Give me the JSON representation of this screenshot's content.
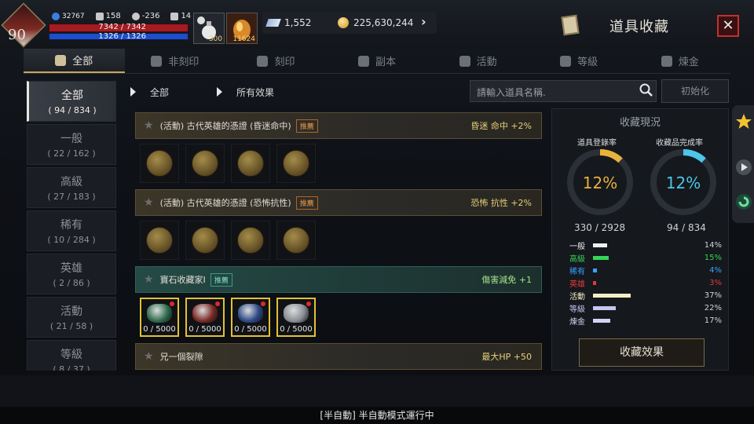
{
  "player": {
    "level": "90",
    "combat_power": "32767",
    "stat_a": "158",
    "stat_b": "-236",
    "stat_c": "14",
    "hp": "7342 / 7342",
    "mp": "1326 / 1326"
  },
  "quick_slots": [
    {
      "icon": "potion-icon",
      "count": "300"
    },
    {
      "icon": "elixir-icon",
      "count": "11624"
    }
  ],
  "currency": {
    "gems": "1,552",
    "gold": "225,630,244"
  },
  "window_title": "道具收藏",
  "tabs": [
    {
      "label": "全部",
      "icon": "book-icon",
      "active": true
    },
    {
      "label": "非刻印",
      "icon": "no-engrave-icon",
      "active": false
    },
    {
      "label": "刻印",
      "icon": "engrave-icon",
      "active": false
    },
    {
      "label": "副本",
      "icon": "dungeon-icon",
      "active": false
    },
    {
      "label": "活動",
      "icon": "gift-icon",
      "active": false
    },
    {
      "label": "等級",
      "icon": "level-icon",
      "active": false
    },
    {
      "label": "煉金",
      "icon": "alchemy-icon",
      "active": false
    }
  ],
  "categories": [
    {
      "name": "全部",
      "count": "( 94 / 834 )",
      "active": true
    },
    {
      "name": "一般",
      "count": "( 22 / 162 )"
    },
    {
      "name": "高級",
      "count": "( 27 / 183 )"
    },
    {
      "name": "稀有",
      "count": "( 10 / 284 )"
    },
    {
      "name": "英雄",
      "count": "( 2 / 86 )"
    },
    {
      "name": "活動",
      "count": "( 21 / 58 )"
    },
    {
      "name": "等級",
      "count": "( 8 / 37 )"
    }
  ],
  "filter": {
    "type": "全部",
    "effect": "所有效果",
    "search_placeholder": "請輸入道具名稱.",
    "reset_label": "初始化"
  },
  "collections": [
    {
      "name": "(活動) 古代英雄的憑證 (昏迷命中)",
      "tag": "推薦",
      "effect": "昏迷 命中 +2%",
      "style": "gold",
      "items": [
        {
          "type": "medal"
        },
        {
          "type": "medal"
        },
        {
          "type": "medal"
        },
        {
          "type": "medal"
        }
      ]
    },
    {
      "name": "(活動) 古代英雄的憑證 (恐怖抗性)",
      "tag": "推薦",
      "effect": "恐怖 抗性 +2%",
      "style": "gold",
      "items": [
        {
          "type": "medal"
        },
        {
          "type": "medal"
        },
        {
          "type": "medal"
        },
        {
          "type": "medal"
        }
      ]
    },
    {
      "name": "寶石收藏家I",
      "tag": "推薦",
      "effect": "傷害減免 +1",
      "style": "teal",
      "items": [
        {
          "type": "gem",
          "color": "#2f6b4c",
          "qty": "0 / 5000"
        },
        {
          "type": "gem",
          "color": "#7a2a26",
          "qty": "0 / 5000"
        },
        {
          "type": "gem",
          "color": "#2c4a86",
          "qty": "0 / 5000"
        },
        {
          "type": "gem",
          "color": "#8a8e96",
          "qty": "0 / 5000"
        }
      ]
    },
    {
      "name": "兄一個裂隙",
      "tag": "",
      "effect": "最大HP +50",
      "style": "gold",
      "items": []
    }
  ],
  "status": {
    "title": "收藏現況",
    "reg_label": "道具登錄率",
    "reg_value": "12%",
    "reg_fraction": 0.12,
    "reg_count": "330 / 2928",
    "comp_label": "收藏品完成率",
    "comp_value": "12%",
    "comp_fraction": 0.12,
    "comp_count": "94 / 834",
    "reg_color": "#e9b23a",
    "comp_color": "#4cc7e8",
    "grades": [
      {
        "name": "一般",
        "color": "#f0f0f0",
        "fraction": 0.14,
        "pct": "14%"
      },
      {
        "name": "高級",
        "color": "#35d45a",
        "fraction": 0.15,
        "pct": "15%"
      },
      {
        "name": "稀有",
        "color": "#3aa0ff",
        "fraction": 0.04,
        "pct": "4%"
      },
      {
        "name": "英雄",
        "color": "#e03a3a",
        "fraction": 0.03,
        "pct": "3%"
      },
      {
        "name": "活動",
        "color": "#f3efc4",
        "fraction": 0.37,
        "pct": "37%"
      },
      {
        "name": "等級",
        "color": "#c7c4ee",
        "fraction": 0.22,
        "pct": "22%"
      },
      {
        "name": "煉金",
        "color": "#d6d3f3",
        "fraction": 0.17,
        "pct": "17%"
      }
    ],
    "effects_button": "收藏效果"
  },
  "bottom_status": "[半自動] 半自動模式運行中"
}
